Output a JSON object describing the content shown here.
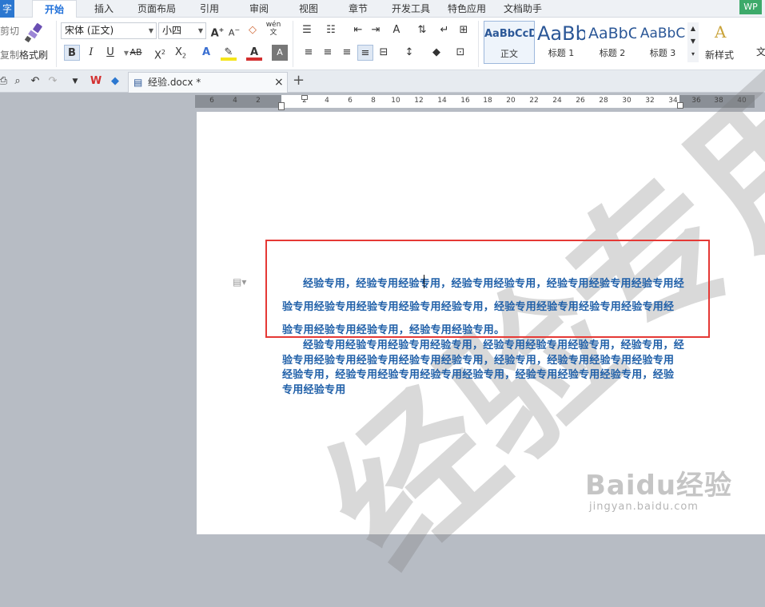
{
  "menubar": {
    "start_label": "字",
    "tabs": [
      "开始",
      "插入",
      "页面布局",
      "引用",
      "审阅",
      "视图",
      "章节",
      "开发工具",
      "特色应用",
      "文档助手"
    ],
    "badge": "WP"
  },
  "ribbon": {
    "cut_label": "剪切",
    "copy_label": "复制",
    "format_painter_label": "格式刷",
    "font_name": "宋体 (正文)",
    "font_size": "小四",
    "pinyin_label": "wén",
    "styles": [
      {
        "sample": "AaBbCcD",
        "name": "正文"
      },
      {
        "sample": "AaBb",
        "name": "标题 1"
      },
      {
        "sample": "AaBbC",
        "name": "标题 2"
      },
      {
        "sample": "AaBbC",
        "name": "标题 3"
      }
    ],
    "new_style_label": "新样式",
    "more_label": "文"
  },
  "doc_tab": {
    "filename": "经验.docx *",
    "close": "×",
    "add": "+"
  },
  "ruler_ticks": [
    "6",
    "4",
    "2",
    "2",
    "4",
    "6",
    "8",
    "10",
    "12",
    "14",
    "16",
    "18",
    "20",
    "22",
    "24",
    "26",
    "28",
    "30",
    "32",
    "34",
    "36",
    "38",
    "40"
  ],
  "document": {
    "paragraph1": "经验专用，经验专用经验专用，经验专用经验专用，经验专用经验专用经验专用经验专用经验专用经验专用经验专用经验专用，经验专用经验专用经验专用经验专用经验专用经验专用经验专用，经验专用经验专用。",
    "paragraph2": "经验专用经验专用经验专用经验专用，经验专用经验专用经验专用，经验专用，经验专用经验专用经验专用经验专用经验专用，经验专用，经验专用经验专用经验专用经验专用，经验专用经验专用经验专用经验专用，经验专用经验专用经验专用，经验专用经验专用",
    "watermark": "经验专用"
  },
  "baidu_watermark": {
    "logo": "Baidu经验",
    "url": "jingyan.baidu.com"
  },
  "colors": {
    "accent": "#1e6fd9",
    "document_text": "#1f5fa8",
    "highlight_border": "#e53935"
  }
}
